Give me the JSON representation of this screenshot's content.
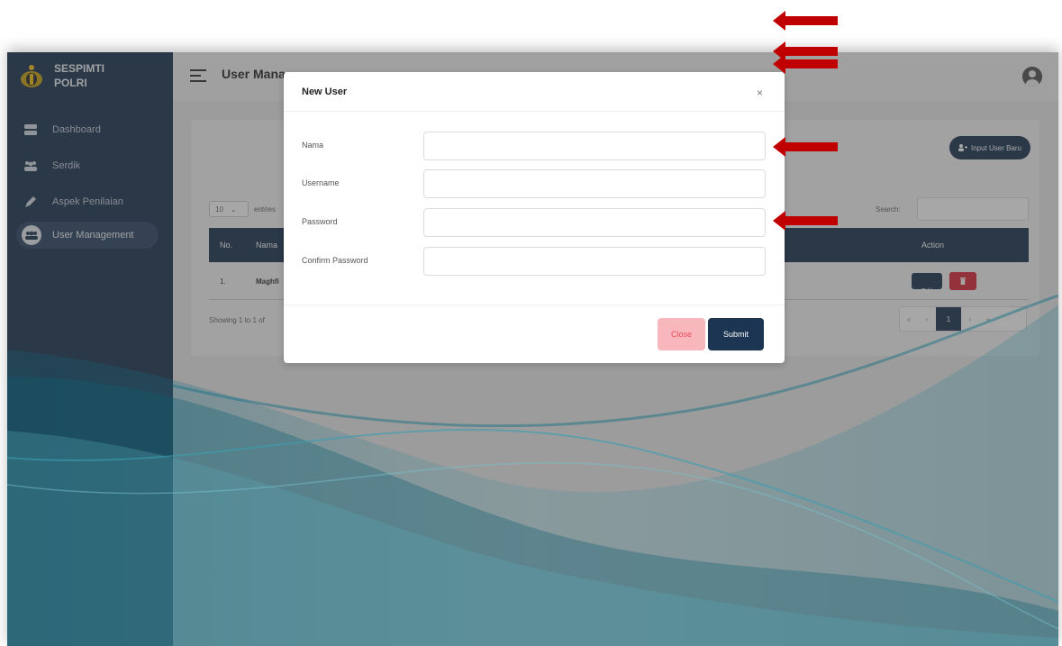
{
  "app": {
    "brand": {
      "line1": "SESPIMTI",
      "line2": "POLRI"
    },
    "page_title": "User Management",
    "page_title_visible": "User Mana"
  },
  "sidebar": {
    "items": [
      {
        "label": "Dashboard",
        "icon": "server-icon",
        "active": false
      },
      {
        "label": "Serdik",
        "icon": "users-icon",
        "active": false
      },
      {
        "label": "Aspek Penilaian",
        "icon": "pen-icon",
        "active": false
      },
      {
        "label": "User Management",
        "icon": "users-circle-icon",
        "active": true
      }
    ]
  },
  "content": {
    "input_user_button": "Input User Baru",
    "entries_value": "10",
    "entries_label": "entries",
    "search_label": "Search:",
    "table": {
      "columns": [
        "No.",
        "Nama",
        "Action"
      ],
      "rows": [
        {
          "no": "1.",
          "nama": "Maghfi"
        }
      ]
    },
    "edit_label": "Edit",
    "showing": "Showing 1 to 1 of",
    "pager": {
      "first": "«",
      "prev": "‹",
      "current": "1",
      "next": "›",
      "last": "»"
    }
  },
  "modal": {
    "title": "New User",
    "close_glyph": "×",
    "fields": [
      {
        "label": "Nama",
        "value": ""
      },
      {
        "label": "Username",
        "value": ""
      },
      {
        "label": "Password",
        "value": ""
      },
      {
        "label": "Confirm Password",
        "value": ""
      }
    ],
    "close_button": "Close",
    "submit_button": "Submit"
  },
  "colors": {
    "sidebar_bg": "#1c3552",
    "primary": "#1c3552",
    "danger": "#dc2b3b",
    "annotation_arrow": "#c00000"
  }
}
